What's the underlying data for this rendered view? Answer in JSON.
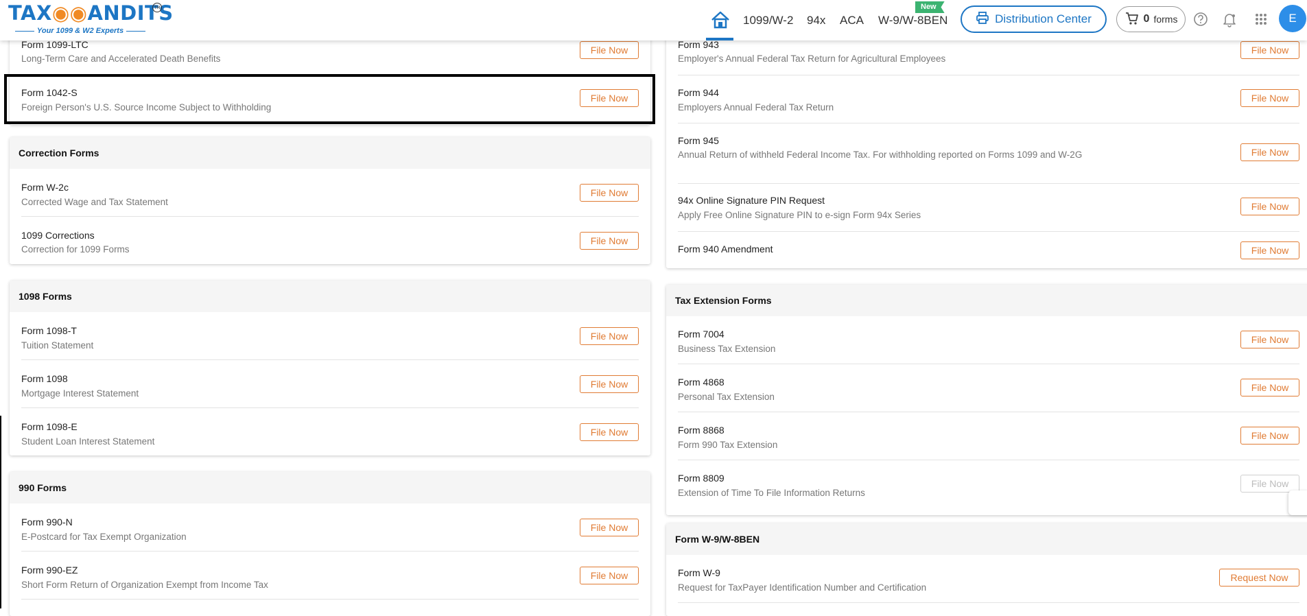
{
  "header": {
    "logo": {
      "left": "TAX",
      "owl": "◉◉",
      "right": "ANDITS",
      "tm": "TM",
      "tagline": "Your 1099 & W2 Experts"
    },
    "nav": [
      "1099/W-2",
      "94x",
      "ACA",
      "W-9/W-8BEN"
    ],
    "new_badge": "New",
    "distribution_center": "Distribution Center",
    "cart": {
      "count": "0",
      "label": "forms"
    },
    "avatar": "E",
    "icons": [
      "home-icon",
      "printer-icon",
      "cart-icon",
      "help-icon",
      "bell-icon",
      "apps-grid-icon"
    ]
  },
  "left": {
    "top_rows": [
      {
        "title": "Form 1099-LTC",
        "sub": "Long-Term Care and Accelerated Death Benefits",
        "btn": "File Now"
      },
      {
        "title": "Form 1042-S",
        "sub": "Foreign Person's U.S. Source Income Subject to Withholding",
        "btn": "File Now"
      }
    ],
    "correction": {
      "title": "Correction Forms",
      "rows": [
        {
          "title": "Form W-2c",
          "sub": "Corrected Wage and Tax Statement",
          "btn": "File Now"
        },
        {
          "title": "1099 Corrections",
          "sub": "Correction for 1099 Forms",
          "btn": "File Now"
        }
      ]
    },
    "f1098": {
      "title": "1098 Forms",
      "rows": [
        {
          "title": "Form 1098-T",
          "sub": "Tuition Statement",
          "btn": "File Now"
        },
        {
          "title": "Form 1098",
          "sub": "Mortgage Interest Statement",
          "btn": "File Now"
        },
        {
          "title": "Form 1098-E",
          "sub": "Student Loan Interest Statement",
          "btn": "File Now"
        }
      ]
    },
    "f990": {
      "title": "990 Forms",
      "rows": [
        {
          "title": "Form 990-N",
          "sub": "E-Postcard for Tax Exempt Organization",
          "btn": "File Now"
        },
        {
          "title": "Form 990-EZ",
          "sub": "Short Form Return of Organization Exempt from Income Tax",
          "btn": "File Now"
        }
      ]
    }
  },
  "right": {
    "top_rows": [
      {
        "title": "Form 943",
        "sub": "Employer's Annual Federal Tax Return for Agricultural Employees",
        "btn": "File Now"
      },
      {
        "title": "Form 944",
        "sub": "Employers Annual Federal Tax Return",
        "btn": "File Now"
      },
      {
        "title": "Form 945",
        "sub": "Annual Return of withheld Federal Income Tax. For withholding reported on Forms 1099 and W-2G",
        "btn": "File Now"
      },
      {
        "title": "94x Online Signature PIN Request",
        "sub": "Apply Free Online Signature PIN to e-sign Form 94x Series",
        "btn": "File Now"
      },
      {
        "title": "Form 940 Amendment",
        "sub": "",
        "btn": "File Now"
      }
    ],
    "extension": {
      "title": "Tax Extension Forms",
      "rows": [
        {
          "title": "Form 7004",
          "sub": "Business Tax Extension",
          "btn": "File Now"
        },
        {
          "title": "Form 4868",
          "sub": "Personal Tax Extension",
          "btn": "File Now"
        },
        {
          "title": "Form 8868",
          "sub": "Form 990 Tax Extension",
          "btn": "File Now"
        },
        {
          "title": "Form 8809",
          "sub": "Extension of Time To File Information Returns",
          "btn": "File Now"
        }
      ]
    },
    "w9": {
      "title": "Form W-9/W-8BEN",
      "rows": [
        {
          "title": "Form W-9",
          "sub": "Request for TaxPayer Identification Number and Certification",
          "btn": "Request Now"
        }
      ]
    }
  },
  "colors": {
    "brand_blue": "#1d76c4",
    "accent_orange": "#e07b33",
    "badge_green": "#3cb371"
  }
}
